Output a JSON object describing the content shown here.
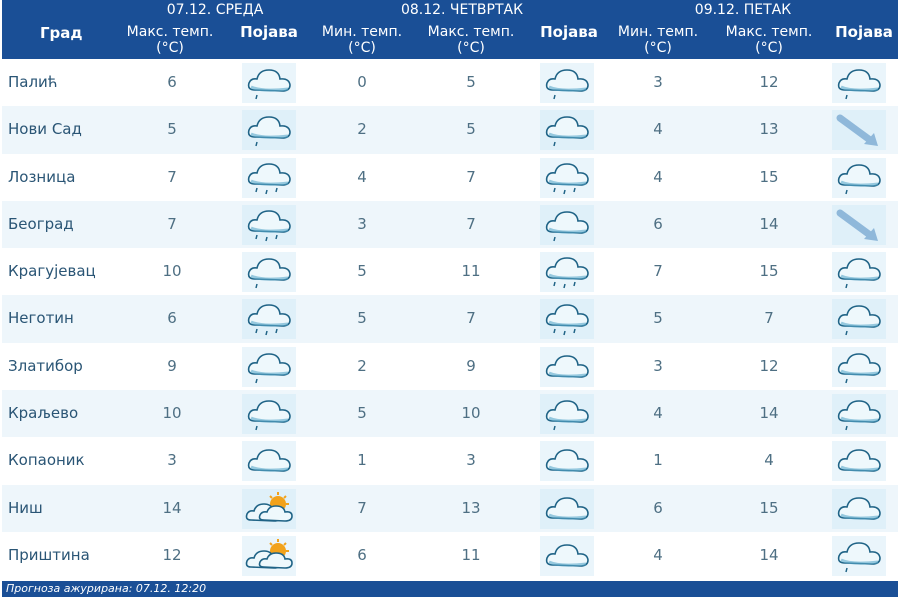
{
  "header": {
    "city_label": "Град",
    "days": [
      {
        "title": "07.12. СРЕДА",
        "max_label": "Макс. темп.\n(°C)",
        "icon_label": "Појава"
      },
      {
        "title": "08.12. ЧЕТВРТАК",
        "min_label": "Мин. темп.\n(°C)",
        "max_label": "Макс. темп.\n(°C)",
        "icon_label": "Појава"
      },
      {
        "title": "09.12. ПЕТАК",
        "min_label": "Мин. темп.\n(°C)",
        "max_label": "Макс. темп.\n(°C)",
        "icon_label": "Појава"
      }
    ]
  },
  "rows": [
    {
      "city": "Палић",
      "d1_max": "6",
      "d1_icon": "cloud-light-rain-icon",
      "d2_min": "0",
      "d2_max": "5",
      "d2_icon": "cloud-light-rain-icon",
      "d3_min": "3",
      "d3_max": "12",
      "d3_icon": "cloud-light-rain-icon"
    },
    {
      "city": "Нови Сад",
      "d1_max": "5",
      "d1_icon": "cloud-light-rain-icon",
      "d2_min": "2",
      "d2_max": "5",
      "d2_icon": "cloud-light-rain-icon",
      "d3_min": "4",
      "d3_max": "13",
      "d3_icon": "wind-arrow-icon"
    },
    {
      "city": "Лозница",
      "d1_max": "7",
      "d1_icon": "cloud-rain-icon",
      "d2_min": "4",
      "d2_max": "7",
      "d2_icon": "cloud-rain-icon",
      "d3_min": "4",
      "d3_max": "15",
      "d3_icon": "cloud-light-rain-icon"
    },
    {
      "city": "Београд",
      "d1_max": "7",
      "d1_icon": "cloud-rain-icon",
      "d2_min": "3",
      "d2_max": "7",
      "d2_icon": "cloud-light-rain-icon",
      "d3_min": "6",
      "d3_max": "14",
      "d3_icon": "wind-arrow-icon"
    },
    {
      "city": "Крагујевац",
      "d1_max": "10",
      "d1_icon": "cloud-light-rain-icon",
      "d2_min": "5",
      "d2_max": "11",
      "d2_icon": "cloud-rain-icon",
      "d3_min": "7",
      "d3_max": "15",
      "d3_icon": "cloud-light-rain-icon"
    },
    {
      "city": "Неготин",
      "d1_max": "6",
      "d1_icon": "cloud-rain-icon",
      "d2_min": "5",
      "d2_max": "7",
      "d2_icon": "cloud-rain-icon",
      "d3_min": "5",
      "d3_max": "7",
      "d3_icon": "cloud-light-rain-icon"
    },
    {
      "city": "Златибор",
      "d1_max": "9",
      "d1_icon": "cloud-light-rain-icon",
      "d2_min": "2",
      "d2_max": "9",
      "d2_icon": "cloud-icon",
      "d3_min": "3",
      "d3_max": "12",
      "d3_icon": "cloud-light-rain-icon"
    },
    {
      "city": "Краљево",
      "d1_max": "10",
      "d1_icon": "cloud-light-rain-icon",
      "d2_min": "5",
      "d2_max": "10",
      "d2_icon": "cloud-light-rain-icon",
      "d3_min": "4",
      "d3_max": "14",
      "d3_icon": "cloud-light-rain-icon"
    },
    {
      "city": "Копаоник",
      "d1_max": "3",
      "d1_icon": "cloud-icon",
      "d2_min": "1",
      "d2_max": "3",
      "d2_icon": "cloud-icon",
      "d3_min": "1",
      "d3_max": "4",
      "d3_icon": "cloud-icon"
    },
    {
      "city": "Ниш",
      "d1_max": "14",
      "d1_icon": "cloud-sun-icon",
      "d2_min": "7",
      "d2_max": "13",
      "d2_icon": "cloud-icon",
      "d3_min": "6",
      "d3_max": "15",
      "d3_icon": "cloud-icon"
    },
    {
      "city": "Приштина",
      "d1_max": "12",
      "d1_icon": "cloud-sun-icon",
      "d2_min": "6",
      "d2_max": "11",
      "d2_icon": "cloud-icon",
      "d3_min": "4",
      "d3_max": "14",
      "d3_icon": "cloud-light-rain-icon"
    }
  ],
  "footer": {
    "text": "Прогноза ажурирана:  07.12.  12:20"
  },
  "colors": {
    "header_bg": "#1a4f96",
    "row_alt_bg": "#eef6fb",
    "text": "#315b76"
  }
}
